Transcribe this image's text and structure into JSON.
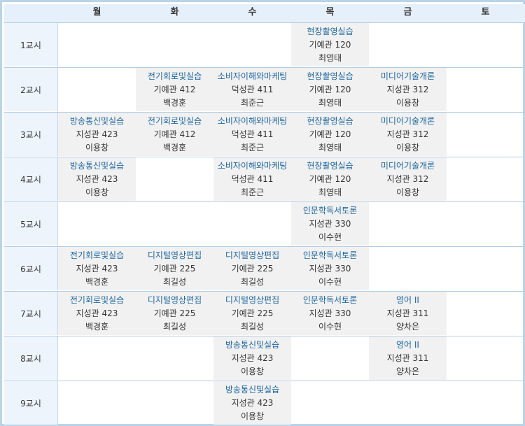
{
  "days": [
    "월",
    "화",
    "수",
    "목",
    "금",
    "토"
  ],
  "periods": [
    {
      "label": "1교시",
      "cells": [
        null,
        null,
        null,
        {
          "course": "현장촬영실습",
          "room": "기예관 120",
          "teacher": "최영태"
        },
        null,
        null
      ]
    },
    {
      "label": "2교시",
      "cells": [
        null,
        {
          "course": "전기회로및실습",
          "room": "기예관 412",
          "teacher": "백경훈"
        },
        {
          "course": "소비자이해와마케팅",
          "room": "덕성관 411",
          "teacher": "최준근"
        },
        {
          "course": "현장촬영실습",
          "room": "기예관 120",
          "teacher": "최영태"
        },
        {
          "course": "미디어기술개론",
          "room": "지성관 312",
          "teacher": "이용창"
        },
        null
      ]
    },
    {
      "label": "3교시",
      "cells": [
        {
          "course": "방송통신및실습",
          "room": "지성관 423",
          "teacher": "이용창"
        },
        {
          "course": "전기회로및실습",
          "room": "기예관 412",
          "teacher": "백경훈"
        },
        {
          "course": "소비자이해와마케팅",
          "room": "덕성관 411",
          "teacher": "최준근"
        },
        {
          "course": "현장촬영실습",
          "room": "기예관 120",
          "teacher": "최영태"
        },
        {
          "course": "미디어기술개론",
          "room": "지성관 312",
          "teacher": "이용창"
        },
        null
      ]
    },
    {
      "label": "4교시",
      "cells": [
        {
          "course": "방송통신및실습",
          "room": "지성관 423",
          "teacher": "이용창"
        },
        null,
        {
          "course": "소비자이해와마케팅",
          "room": "덕성관 411",
          "teacher": "최준근"
        },
        {
          "course": "현장촬영실습",
          "room": "기예관 120",
          "teacher": "최영태"
        },
        {
          "course": "미디어기술개론",
          "room": "지성관 312",
          "teacher": "이용창"
        },
        null
      ]
    },
    {
      "label": "5교시",
      "cells": [
        null,
        null,
        null,
        {
          "course": "인문학독서토론",
          "room": "지성관 330",
          "teacher": "이수현"
        },
        null,
        null
      ]
    },
    {
      "label": "6교시",
      "cells": [
        {
          "course": "전기회로및실습",
          "room": "지성관 423",
          "teacher": "백경훈"
        },
        {
          "course": "디지털영상편집",
          "room": "기예관 225",
          "teacher": "최길성"
        },
        {
          "course": "디지털영상편집",
          "room": "기예관 225",
          "teacher": "최길성"
        },
        {
          "course": "인문학독서토론",
          "room": "지성관 330",
          "teacher": "이수현"
        },
        null,
        null
      ]
    },
    {
      "label": "7교시",
      "cells": [
        {
          "course": "전기회로및실습",
          "room": "지성관 423",
          "teacher": "백경훈"
        },
        {
          "course": "디지털영상편집",
          "room": "기예관 225",
          "teacher": "최길성"
        },
        {
          "course": "디지털영상편집",
          "room": "기예관 225",
          "teacher": "최길성"
        },
        {
          "course": "인문학독서토론",
          "room": "지성관 330",
          "teacher": "이수현"
        },
        {
          "course": "영어 II",
          "room": "지성관 311",
          "teacher": "양차은"
        },
        null
      ]
    },
    {
      "label": "8교시",
      "cells": [
        null,
        null,
        {
          "course": "방송통신및실습",
          "room": "지성관 423",
          "teacher": "이용창"
        },
        null,
        {
          "course": "영어 II",
          "room": "지성관 311",
          "teacher": "양차은"
        },
        null
      ]
    },
    {
      "label": "9교시",
      "cells": [
        null,
        null,
        {
          "course": "방송통신및실습",
          "room": "지성관 423",
          "teacher": "이용창"
        },
        null,
        null,
        null
      ]
    }
  ]
}
